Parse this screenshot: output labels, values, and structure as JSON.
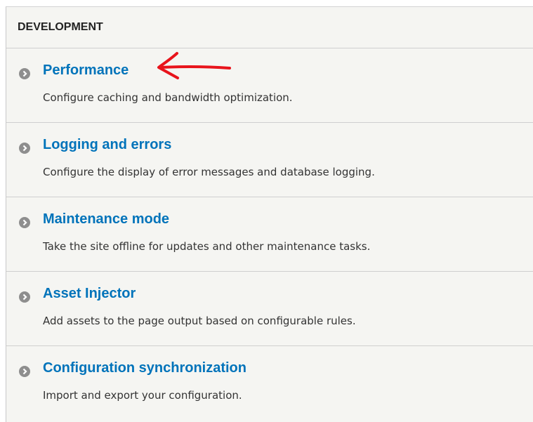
{
  "section": {
    "title": "DEVELOPMENT",
    "items": [
      {
        "label": "Performance",
        "description": "Configure caching and bandwidth optimization."
      },
      {
        "label": "Logging and errors",
        "description": "Configure the display of error messages and database logging."
      },
      {
        "label": "Maintenance mode",
        "description": "Take the site offline for updates and other maintenance tasks."
      },
      {
        "label": "Asset Injector",
        "description": "Add assets to the page output based on configurable rules."
      },
      {
        "label": "Configuration synchronization",
        "description": "Import and export your configuration."
      }
    ]
  },
  "colors": {
    "link": "#0073ba",
    "annotation_arrow": "#e8141c",
    "icon": "#8e8e8e"
  },
  "icons": {
    "item_icon": "chevron-circle-right-icon",
    "annotation": "red-arrow-icon"
  }
}
